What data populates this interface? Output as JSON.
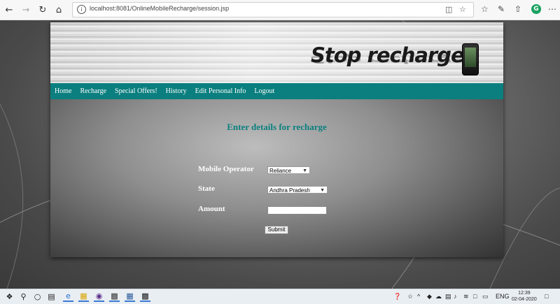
{
  "browser": {
    "url": "localhost:8081/OnlineMobileRecharge/session.jsp",
    "icons": [
      "back-icon",
      "forward-icon",
      "refresh-icon",
      "home-icon",
      "info-icon",
      "reading-view-icon",
      "favorite-star-icon",
      "favorites-icon",
      "pen-icon",
      "share-icon",
      "grammarly-icon",
      "more-icon"
    ],
    "grammarly_label": "G"
  },
  "site": {
    "logo_text": "Stop recharge",
    "nav": [
      "Home",
      "Recharge",
      "Special Offers!",
      "History",
      "Edit Personal Info",
      "Logout"
    ]
  },
  "form": {
    "heading": "Enter details for recharge",
    "operator_label": "Mobile Operator",
    "operator_value": "Reliance",
    "state_label": "State",
    "state_value": "Andhra Pradesh",
    "amount_label": "Amount",
    "amount_value": "",
    "submit_label": "Submit"
  },
  "taskbar": {
    "language": "ENG",
    "time": "12:39",
    "date": "02-04-2020"
  }
}
